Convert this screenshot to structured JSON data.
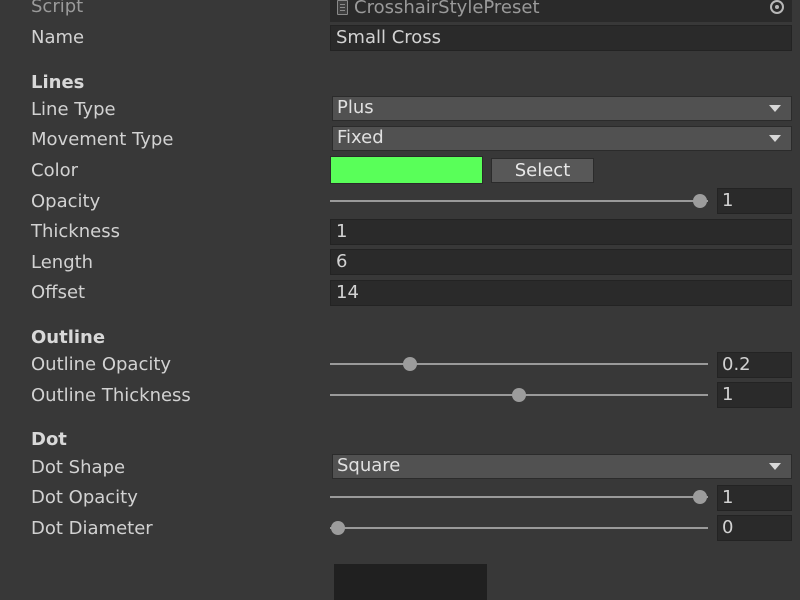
{
  "script": {
    "label": "Script",
    "value": "CrosshairStylePreset"
  },
  "name": {
    "label": "Name",
    "value": "Small Cross"
  },
  "lines": {
    "header": "Lines",
    "line_type": {
      "label": "Line Type",
      "value": "Plus"
    },
    "movement_type": {
      "label": "Movement Type",
      "value": "Fixed"
    },
    "color": {
      "label": "Color",
      "swatch": "#59ff59",
      "button": "Select"
    },
    "opacity": {
      "label": "Opacity",
      "value": "1",
      "fraction": 1
    },
    "thickness": {
      "label": "Thickness",
      "value": "1"
    },
    "length": {
      "label": "Length",
      "value": "6"
    },
    "offset": {
      "label": "Offset",
      "value": "14"
    }
  },
  "outline": {
    "header": "Outline",
    "opacity": {
      "label": "Outline Opacity",
      "value": "0.2",
      "fraction": 0.2
    },
    "thickness": {
      "label": "Outline Thickness",
      "value": "1",
      "fraction": 0.5
    }
  },
  "dot": {
    "header": "Dot",
    "shape": {
      "label": "Dot Shape",
      "value": "Square"
    },
    "opacity": {
      "label": "Dot Opacity",
      "value": "1",
      "fraction": 1
    },
    "diameter": {
      "label": "Dot Diameter",
      "value": "0",
      "fraction": 0
    }
  },
  "icons": {
    "script_asset": "script-file-icon",
    "object_picker": "target-icon",
    "dropdown": "chevron-down-icon"
  }
}
